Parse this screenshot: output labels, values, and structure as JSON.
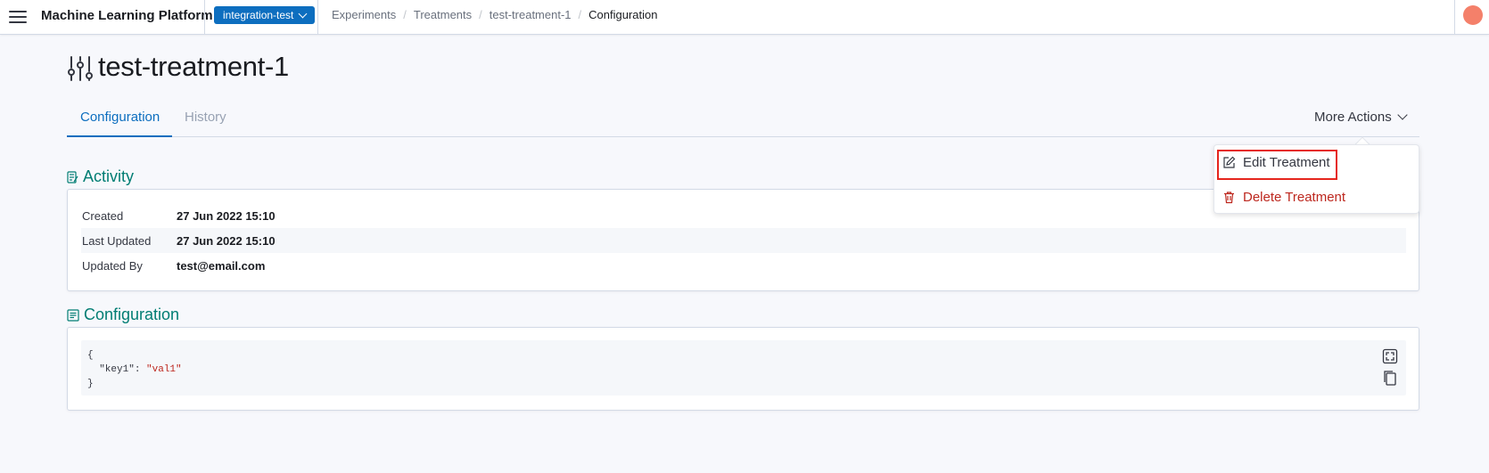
{
  "header": {
    "app_title": "Machine Learning Platform",
    "project": "integration-test",
    "breadcrumbs": [
      "Experiments",
      "Treatments",
      "test-treatment-1",
      "Configuration"
    ],
    "breadcrumb_separator": "/"
  },
  "page": {
    "title": "test-treatment-1",
    "tabs": [
      {
        "label": "Configuration",
        "active": true
      },
      {
        "label": "History",
        "active": false
      }
    ],
    "more_actions_label": "More Actions"
  },
  "more_actions_menu": {
    "items": [
      {
        "label": "Edit Treatment",
        "icon": "edit-icon"
      },
      {
        "label": "Delete Treatment",
        "icon": "trash-icon",
        "color": "#bd271e"
      }
    ]
  },
  "activity": {
    "heading": "Activity",
    "rows": [
      {
        "label": "Created",
        "value": "27 Jun 2022 15:10"
      },
      {
        "label": "Last Updated",
        "value": "27 Jun 2022 15:10"
      },
      {
        "label": "Updated By",
        "value": "test@email.com"
      }
    ]
  },
  "configuration": {
    "heading": "Configuration",
    "code": {
      "open": "{",
      "key": "\"key1\"",
      "colon": ": ",
      "value": "\"val1\"",
      "close": "}"
    }
  },
  "colors": {
    "primary": "#0d6ebf",
    "section_heading": "#017d73",
    "danger": "#bd271e",
    "avatar": "#f4806a",
    "highlight": "#e5251d"
  }
}
